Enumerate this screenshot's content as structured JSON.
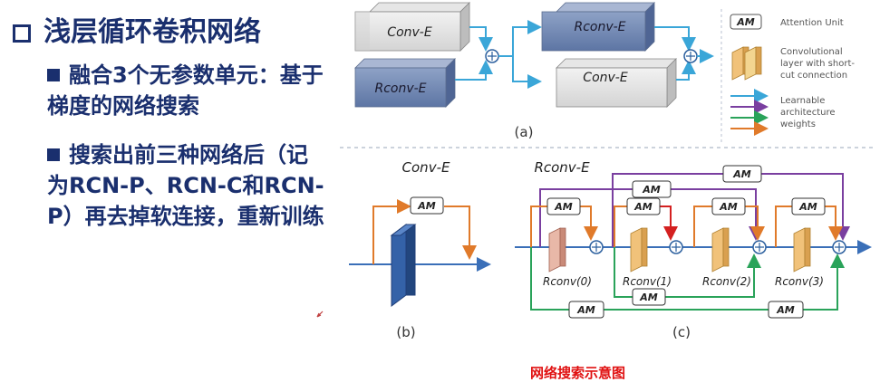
{
  "slide": {
    "title": "浅层循环卷积网络",
    "bullet1": "融合3个无参数单元：基于梯度的网络搜索",
    "bullet2": "搜索出前三种网络后（记为RCN-P、RCN-C和RCN-P）再去掉软连接，重新训练"
  },
  "figure": {
    "a": {
      "block_conv": "Conv-E",
      "block_rconv": "Rconv-E",
      "label": "(a)"
    },
    "legend": {
      "am_tag": "AM",
      "am_text": "Attention Unit",
      "conv_text": [
        "Convolutional",
        "layer with short-",
        "cut connection"
      ],
      "arrow_text": [
        "Learnable",
        "architecture",
        "weights"
      ],
      "arrow_colors": [
        "#3aa6d8",
        "#7a3fa0",
        "#2aa35a",
        "#e07a2a"
      ]
    },
    "b": {
      "title": "Conv-E",
      "am": "AM",
      "label": "(b)"
    },
    "c": {
      "title": "Rconv-E",
      "am": "AM",
      "units": [
        "Rconv(0)",
        "Rconv(1)",
        "Rconv(2)",
        "Rconv(3)"
      ],
      "label": "(c)"
    },
    "caption": "网络搜索示意图"
  },
  "colors": {
    "title_blue": "#1a2f6e",
    "caption_red": "#e01010",
    "blue_arrow": "#3a6fb8",
    "orange": "#e07a2a",
    "purple": "#7a3fa0",
    "green": "#2aa35a",
    "cyan": "#3aa6d8",
    "red": "#d42020"
  }
}
